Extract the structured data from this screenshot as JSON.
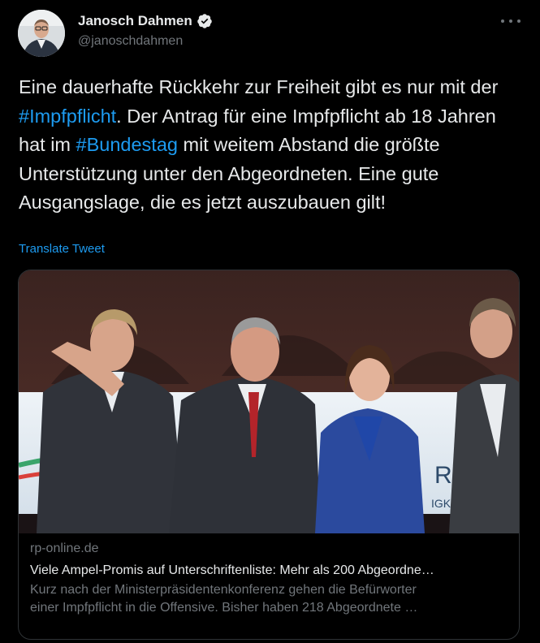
{
  "author": {
    "display_name": "Janosch Dahmen",
    "handle": "@janoschdahmen",
    "verified_icon": "verified-badge-icon",
    "avatar_icon": "avatar"
  },
  "tweet": {
    "text_parts": [
      {
        "text": "Eine dauerhafte Rückkehr zur Freiheit gibt es nur mit der ",
        "hashtag": false
      },
      {
        "text": "#Impfpflicht",
        "hashtag": true
      },
      {
        "text": ". Der Antrag für eine Impfpflicht ab 18 Jahren hat im ",
        "hashtag": false
      },
      {
        "text": "#Bundestag",
        "hashtag": true
      },
      {
        "text": " mit weitem Abstand die größte Unterstützung unter den Abgeordneten. Eine gute Ausgangslage, die es jetzt auszubauen gilt!",
        "hashtag": false
      }
    ],
    "translate_label": "Translate Tweet"
  },
  "card": {
    "domain": "rp-online.de",
    "title": "Viele Ampel-Promis auf Unterschriftenliste: Mehr als 200 Abgeordne…",
    "description_line1": "Kurz nach der Ministerpräsidentenkonferenz gehen die Befürworter",
    "description_line2": "einer Impfpflicht in die Offensive. Bisher haben 218 Abgeordnete …",
    "image_text_1": "RIT",
    "image_text_2": "IGKE"
  },
  "colors": {
    "background": "#000000",
    "text": "#e7e9ea",
    "secondary": "#71767b",
    "link": "#1d9bf0",
    "border": "#2f3336"
  }
}
